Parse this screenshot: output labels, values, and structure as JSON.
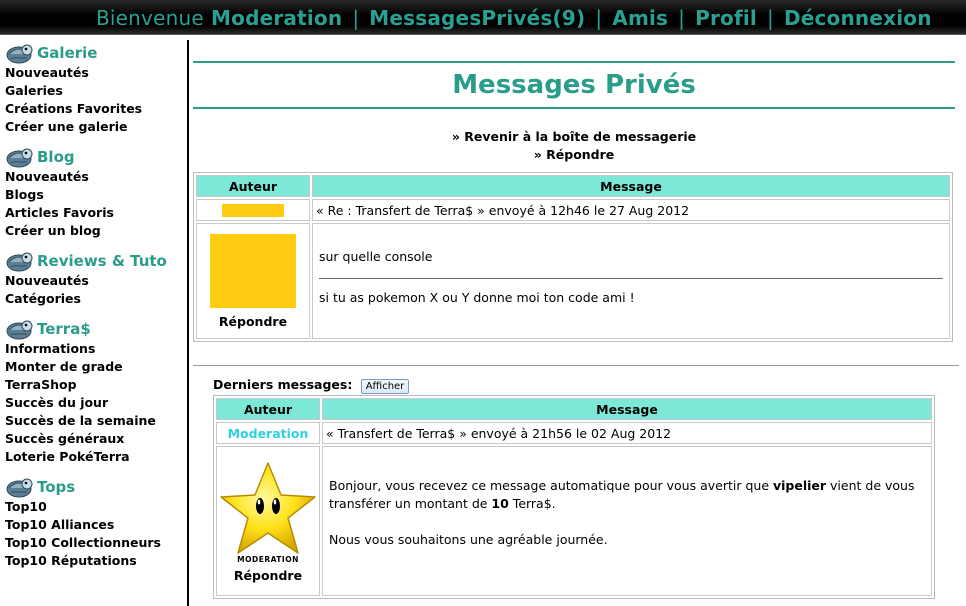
{
  "topbar": {
    "welcome": "Bienvenue",
    "username": "Moderation",
    "messages": "MessagesPrivés(9)",
    "friends": "Amis",
    "profile": "Profil",
    "logout": "Déconnexion",
    "separator": "|"
  },
  "sidebar": {
    "sections": [
      {
        "title": "Galerie",
        "items": [
          "Nouveautés",
          "Galeries",
          "Créations Favorites",
          "Créer une galerie"
        ]
      },
      {
        "title": "Blog",
        "items": [
          "Nouveautés",
          "Blogs",
          "Articles Favoris",
          "Créer un blog"
        ]
      },
      {
        "title": "Reviews & Tuto",
        "items": [
          "Nouveautés",
          "Catégories"
        ]
      },
      {
        "title": "Terra$",
        "items": [
          "Informations",
          "Monter de grade",
          "TerraShop",
          "Succès du jour",
          "Succès de la semaine",
          "Succès généraux",
          "Loterie PokéTerra"
        ]
      },
      {
        "title": "Tops",
        "items": [
          "Top10",
          "Top10 Alliances",
          "Top10 Collectionneurs",
          "Top10 Réputations"
        ]
      }
    ]
  },
  "main": {
    "title": "Messages Privés",
    "back_link": "» Revenir à la boîte de messagerie",
    "reply_link": "» Répondre",
    "table_headers": {
      "author": "Auteur",
      "message": "Message"
    },
    "message": {
      "subject": "« Re : Transfert de Terra$ » envoyé à 12h46 le 27 Aug 2012",
      "paragraph1": "sur quelle console",
      "paragraph2": "si tu as pokemon X ou Y donne moi ton code ami !",
      "reply_label": "Répondre"
    },
    "last_messages": {
      "label": "Derniers messages:",
      "button": "Afficher",
      "author": "Moderation",
      "subject": "« Transfert de Terra$ » envoyé à 21h56 le 02 Aug 2012",
      "body_before": "Bonjour, vous recevez ce message automatique pour vous avertir que ",
      "user_bold": "vipelier",
      "body_middle": " vient de vous transférer un montant de ",
      "amount_bold": "10",
      "body_after": " Terra$.",
      "paragraph2": "Nous vous souhaitons une agréable journée.",
      "avatar_caption": "MODERATION",
      "reply_label": "Répondre"
    }
  },
  "colors": {
    "accent": "#2a9d8a",
    "header_cell": "#7ee8d8",
    "avatar_yellow": "#ffcc11",
    "mod_name": "#2fd0e0"
  },
  "icons": {
    "section_icon": "pokeball-shell-icon",
    "moderation_avatar": "star-icon"
  }
}
